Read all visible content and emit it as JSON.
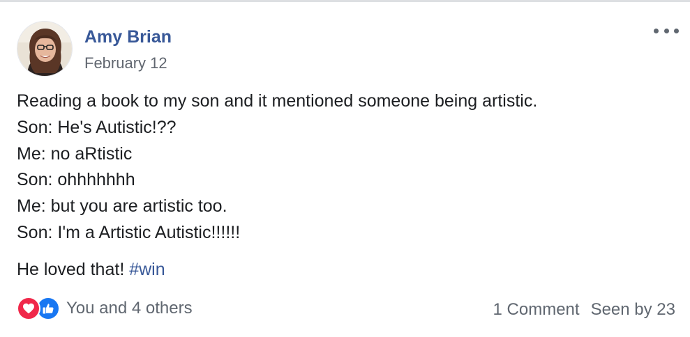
{
  "post": {
    "author": "Amy Brian",
    "date": "February 12",
    "body_lines": [
      "Reading a book to my son and it mentioned someone being artistic.",
      "Son: He's Autistic!??",
      "Me: no aRtistic",
      "Son: ohhhhhhh",
      "Me: but you are artistic too.",
      "Son: I'm a Artistic Autistic!!!!!!"
    ],
    "closing_text": "He loved that!",
    "hashtag": "#win"
  },
  "reactions": {
    "icons": [
      "love-icon",
      "like-icon"
    ],
    "summary": "You and 4 others"
  },
  "stats": {
    "comments": "1 Comment",
    "seen_by": "Seen by 23"
  },
  "colors": {
    "author_link": "#385898",
    "secondary_text": "#616770",
    "love": "#f0284a",
    "like": "#1877f2"
  }
}
